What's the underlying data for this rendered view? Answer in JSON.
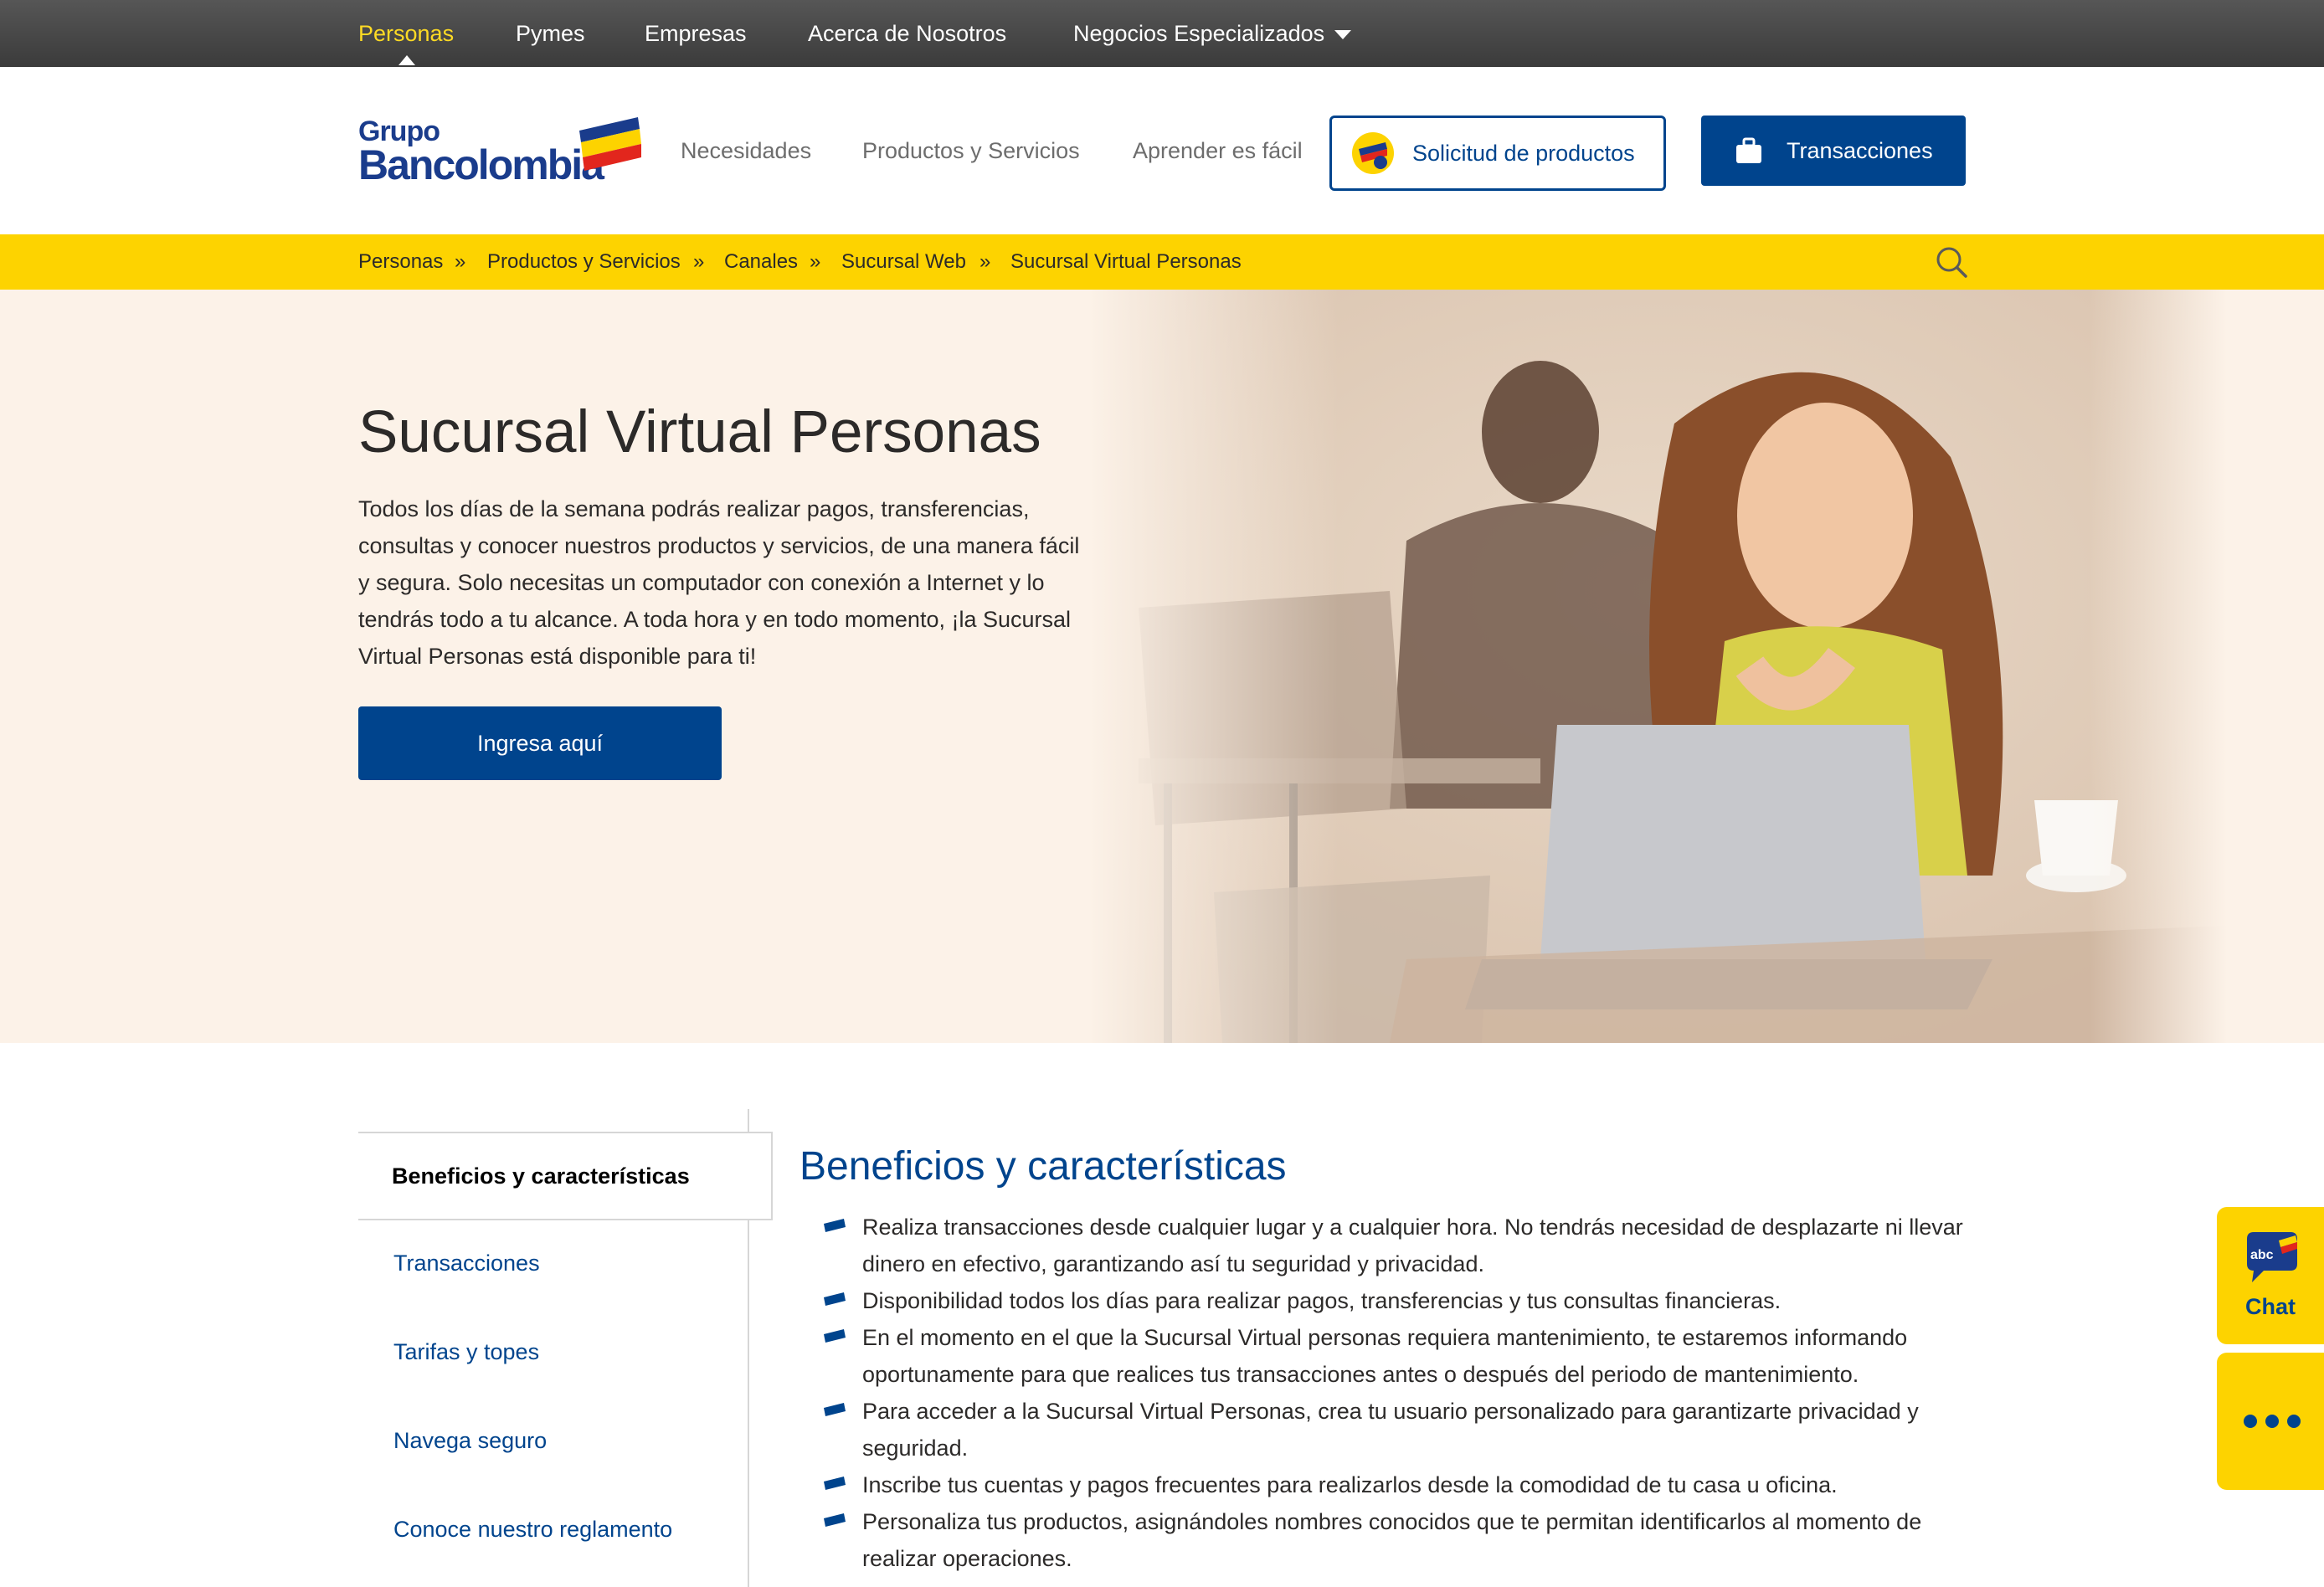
{
  "topbar": {
    "items": [
      "Personas",
      "Pymes",
      "Empresas",
      "Acerca de Nosotros",
      "Negocios Especializados"
    ],
    "active": "Personas"
  },
  "header": {
    "logo": {
      "line1": "Grupo",
      "line2": "Bancolombia"
    },
    "nav": [
      "Necesidades",
      "Productos y Servicios",
      "Aprender es fácil"
    ],
    "solicitud_label": "Solicitud de productos",
    "transacciones_label": "Transacciones"
  },
  "breadcrumb": {
    "items": [
      "Personas",
      "Productos y Servicios",
      "Canales",
      "Sucursal Web",
      "Sucursal Virtual Personas"
    ],
    "separator": "»"
  },
  "hero": {
    "title": "Sucursal Virtual Personas",
    "text": "Todos los días de la semana podrás realizar pagos, transferencias, consultas y conocer nuestros productos y servicios, de una manera fácil y segura. Solo necesitas un computador con conexión a Internet y lo tendrás todo a tu alcance. A toda hora y en todo momento, ¡la Sucursal Virtual Personas está disponible para ti!",
    "button": "Ingresa aquí"
  },
  "sidebar": {
    "active": "Beneficios y características",
    "items": [
      "Transacciones",
      "Tarifas y topes",
      "Navega seguro",
      "Conoce nuestro reglamento"
    ]
  },
  "content": {
    "title": "Beneficios y características",
    "benefits": [
      "Realiza transacciones desde cualquier lugar y a cualquier hora. No tendrás necesidad de desplazarte ni llevar dinero en efectivo, garantizando así tu seguridad y privacidad.",
      "Disponibilidad todos los días para realizar pagos, transferencias y tus consultas financieras.",
      "En el momento en el que la Sucursal Virtual personas requiera mantenimiento, te estaremos informando oportunamente para que realices tus transacciones antes o después del periodo de mantenimiento.",
      "Para acceder a la Sucursal Virtual Personas, crea tu usuario personalizado para garantizarte privacidad y seguridad.",
      "Inscribe tus cuentas y pagos frecuentes para realizarlos desde la comodidad de tu casa u oficina.",
      "Personaliza tus productos, asignándoles nombres conocidos que te permitan identificarlos al momento de realizar operaciones."
    ]
  },
  "chat": {
    "label": "Chat",
    "badge": "abc"
  },
  "colors": {
    "brand_blue": "#00448d",
    "brand_yellow": "#fdd300",
    "topbar_active": "#fdda24",
    "hero_bg": "#fcf2e8"
  },
  "icons": [
    "dropdown-caret-icon",
    "bancolombia-flag-icon",
    "product-request-icon",
    "briefcase-icon",
    "search-icon",
    "bullet-icon",
    "chat-bubble-icon",
    "more-dots-icon"
  ]
}
